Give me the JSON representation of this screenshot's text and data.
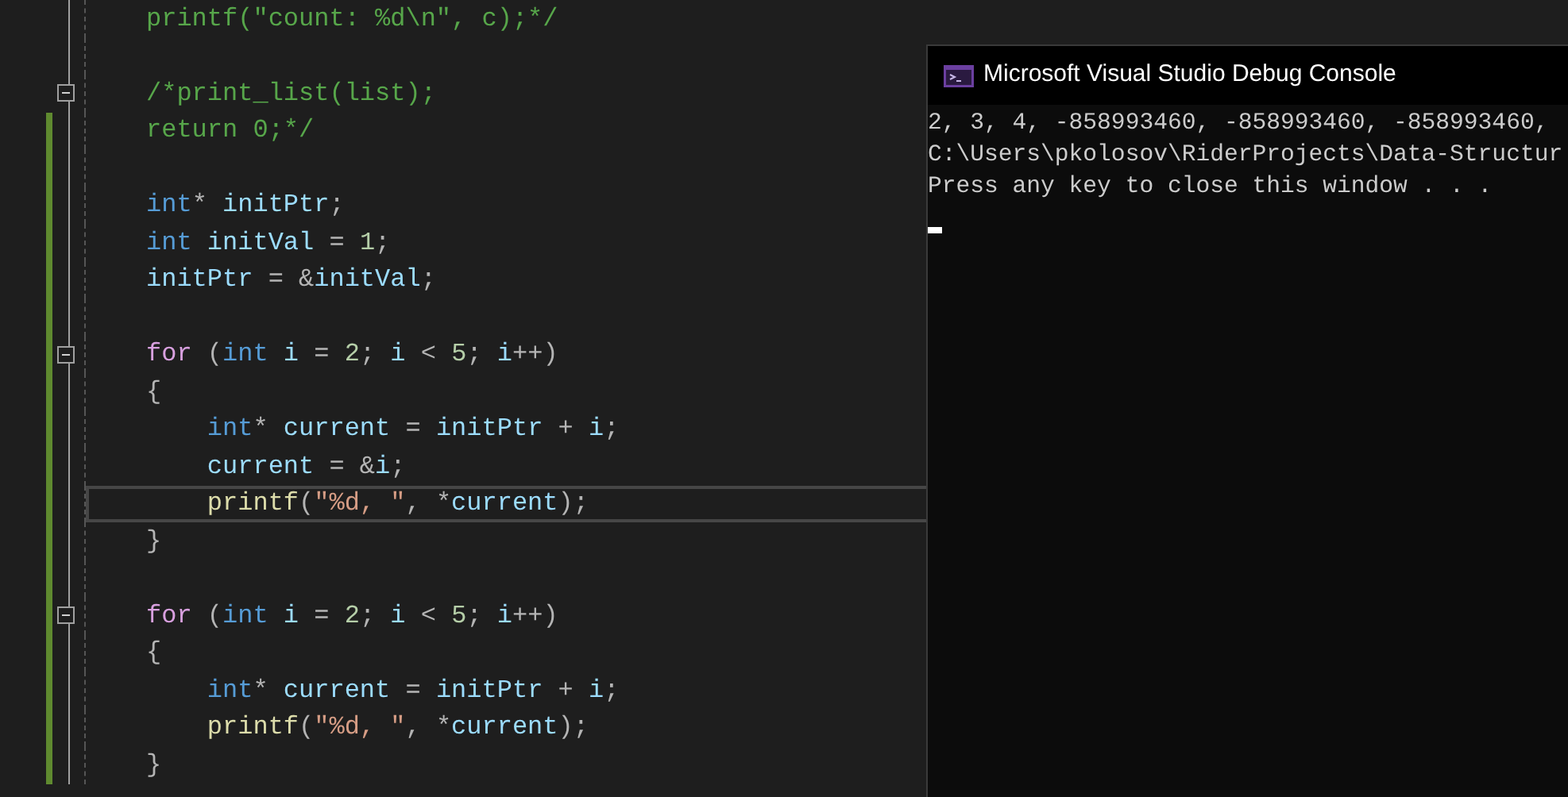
{
  "editor": {
    "lines": [
      {
        "changed": false,
        "fold": false,
        "current": false,
        "tokens": [
          {
            "text": "printf(\"count: %d\\n\", c);*/",
            "kind": "cmt"
          }
        ]
      },
      {
        "changed": false,
        "fold": false,
        "current": false
      },
      {
        "changed": false,
        "fold": true,
        "current": false,
        "tokens": [
          {
            "text": "/*print_list(list);",
            "kind": "cmt"
          }
        ]
      },
      {
        "changed": true,
        "fold": false,
        "current": false,
        "tokens": [
          {
            "text": "return 0;*/",
            "kind": "cmt"
          }
        ]
      },
      {
        "changed": true,
        "fold": false,
        "current": false
      },
      {
        "changed": true,
        "fold": false,
        "current": false,
        "tokens": [
          {
            "text": "int",
            "kind": "kw"
          },
          {
            "text": "* ",
            "kind": "pun"
          },
          {
            "text": "initPtr",
            "kind": "id"
          },
          {
            "text": ";",
            "kind": "pun"
          }
        ]
      },
      {
        "changed": true,
        "fold": false,
        "current": false,
        "tokens": [
          {
            "text": "int",
            "kind": "kw"
          },
          {
            "text": " initVal",
            "kind": "id"
          },
          {
            "text": " = ",
            "kind": "pun"
          },
          {
            "text": "1",
            "kind": "num"
          },
          {
            "text": ";",
            "kind": "pun"
          }
        ]
      },
      {
        "changed": true,
        "fold": false,
        "current": false,
        "tokens": [
          {
            "text": "initPtr",
            "kind": "id"
          },
          {
            "text": " = &",
            "kind": "pun"
          },
          {
            "text": "initVal",
            "kind": "id"
          },
          {
            "text": ";",
            "kind": "pun"
          }
        ]
      },
      {
        "changed": true,
        "fold": false,
        "current": false
      },
      {
        "changed": true,
        "fold": true,
        "current": false,
        "tokens": [
          {
            "text": "for",
            "kind": "ctl"
          },
          {
            "text": " (",
            "kind": "pun"
          },
          {
            "text": "int",
            "kind": "kw"
          },
          {
            "text": " i",
            "kind": "id"
          },
          {
            "text": " = ",
            "kind": "pun"
          },
          {
            "text": "2",
            "kind": "num"
          },
          {
            "text": "; ",
            "kind": "pun"
          },
          {
            "text": "i",
            "kind": "id"
          },
          {
            "text": " < ",
            "kind": "pun"
          },
          {
            "text": "5",
            "kind": "num"
          },
          {
            "text": "; ",
            "kind": "pun"
          },
          {
            "text": "i",
            "kind": "id"
          },
          {
            "text": "++)",
            "kind": "pun"
          }
        ]
      },
      {
        "changed": true,
        "fold": false,
        "current": false,
        "tokens": [
          {
            "text": "{",
            "kind": "pun"
          }
        ]
      },
      {
        "changed": true,
        "fold": false,
        "current": false,
        "tokens": [
          {
            "text": "    int",
            "kind": "kw"
          },
          {
            "text": "* ",
            "kind": "pun"
          },
          {
            "text": "current",
            "kind": "id"
          },
          {
            "text": " = ",
            "kind": "pun"
          },
          {
            "text": "initPtr",
            "kind": "id"
          },
          {
            "text": " + ",
            "kind": "pun"
          },
          {
            "text": "i",
            "kind": "id"
          },
          {
            "text": ";",
            "kind": "pun"
          }
        ]
      },
      {
        "changed": true,
        "fold": false,
        "current": false,
        "tokens": [
          {
            "text": "    current",
            "kind": "id"
          },
          {
            "text": " = &",
            "kind": "pun"
          },
          {
            "text": "i",
            "kind": "id"
          },
          {
            "text": ";",
            "kind": "pun"
          }
        ]
      },
      {
        "changed": true,
        "fold": false,
        "current": true,
        "tokens": [
          {
            "text": "    printf",
            "kind": "fn"
          },
          {
            "text": "(",
            "kind": "pun"
          },
          {
            "text": "\"%d, \"",
            "kind": "str"
          },
          {
            "text": ", *",
            "kind": "pun"
          },
          {
            "text": "current",
            "kind": "id"
          },
          {
            "text": ");",
            "kind": "pun"
          }
        ]
      },
      {
        "changed": true,
        "fold": false,
        "current": false,
        "tokens": [
          {
            "text": "}",
            "kind": "pun"
          }
        ]
      },
      {
        "changed": true,
        "fold": false,
        "current": false
      },
      {
        "changed": true,
        "fold": true,
        "current": false,
        "tokens": [
          {
            "text": "for",
            "kind": "ctl"
          },
          {
            "text": " (",
            "kind": "pun"
          },
          {
            "text": "int",
            "kind": "kw"
          },
          {
            "text": " i",
            "kind": "id"
          },
          {
            "text": " = ",
            "kind": "pun"
          },
          {
            "text": "2",
            "kind": "num"
          },
          {
            "text": "; ",
            "kind": "pun"
          },
          {
            "text": "i",
            "kind": "id"
          },
          {
            "text": " < ",
            "kind": "pun"
          },
          {
            "text": "5",
            "kind": "num"
          },
          {
            "text": "; ",
            "kind": "pun"
          },
          {
            "text": "i",
            "kind": "id"
          },
          {
            "text": "++)",
            "kind": "pun"
          }
        ]
      },
      {
        "changed": true,
        "fold": false,
        "current": false,
        "tokens": [
          {
            "text": "{",
            "kind": "pun"
          }
        ]
      },
      {
        "changed": true,
        "fold": false,
        "current": false,
        "tokens": [
          {
            "text": "    int",
            "kind": "kw"
          },
          {
            "text": "* ",
            "kind": "pun"
          },
          {
            "text": "current",
            "kind": "id"
          },
          {
            "text": " = ",
            "kind": "pun"
          },
          {
            "text": "initPtr",
            "kind": "id"
          },
          {
            "text": " + ",
            "kind": "pun"
          },
          {
            "text": "i",
            "kind": "id"
          },
          {
            "text": ";",
            "kind": "pun"
          }
        ]
      },
      {
        "changed": true,
        "fold": false,
        "current": false,
        "tokens": [
          {
            "text": "    printf",
            "kind": "fn"
          },
          {
            "text": "(",
            "kind": "pun"
          },
          {
            "text": "\"%d, \"",
            "kind": "str"
          },
          {
            "text": ", *",
            "kind": "pun"
          },
          {
            "text": "current",
            "kind": "id"
          },
          {
            "text": ");",
            "kind": "pun"
          }
        ]
      },
      {
        "changed": true,
        "fold": false,
        "current": false,
        "tokens": [
          {
            "text": "}",
            "kind": "pun"
          }
        ]
      }
    ]
  },
  "console": {
    "title": "Microsoft Visual Studio Debug Console",
    "lines": [
      "2, 3, 4, -858993460, -858993460, -858993460,",
      "C:\\Users\\pkolosov\\RiderProjects\\Data-Structur",
      "Press any key to close this window . . ."
    ]
  }
}
